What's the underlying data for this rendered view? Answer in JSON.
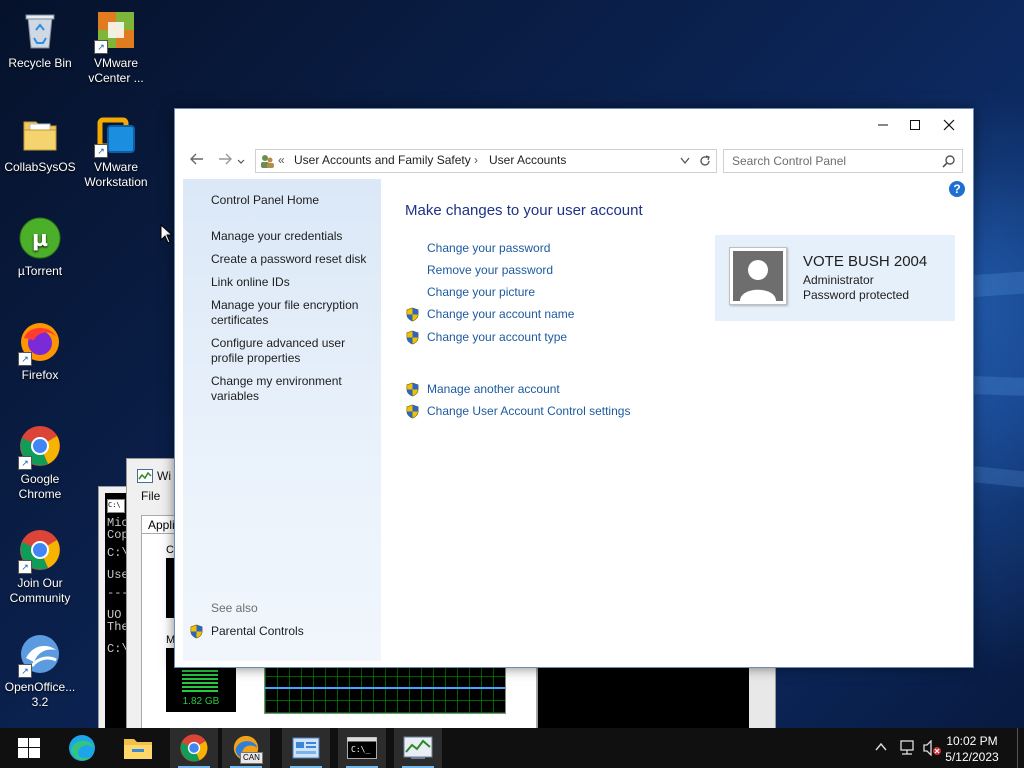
{
  "desktop": {
    "icons": [
      {
        "label": "Recycle Bin"
      },
      {
        "label": "VMware vCenter ..."
      },
      {
        "label": "CollabSysOS"
      },
      {
        "label": "VMware Workstation"
      },
      {
        "label": "µTorrent"
      },
      {
        "label": "Firefox"
      },
      {
        "label": "Google Chrome"
      },
      {
        "label": "Join Our Community"
      },
      {
        "label": "OpenOffice... 3.2"
      }
    ]
  },
  "background_windows": {
    "taskmgr_title": "Wi",
    "taskmgr_menu": "File",
    "taskmgr_tab": "Applic",
    "taskmgr_cpu": "CP",
    "taskmgr_mem": "Me",
    "taskmgr_mem_value": "1.82 GB",
    "cmd_lines": [
      "Mic",
      "Cop",
      "C:\\",
      "Use",
      "---",
      "UO",
      "The",
      "C:\\"
    ]
  },
  "window": {
    "breadcrumb": {
      "prefix": "«",
      "parent": "User Accounts and Family Safety",
      "separator": "›",
      "current": "User Accounts"
    },
    "search_placeholder": "Search Control Panel",
    "help_label": "?",
    "left_pane": {
      "home": "Control Panel Home",
      "links": [
        "Manage your credentials",
        "Create a password reset disk",
        "Link online IDs",
        "Manage your file encryption certificates",
        "Configure advanced user profile properties",
        "Change my environment variables"
      ],
      "see_also_label": "See also",
      "see_also": "Parental Controls"
    },
    "main": {
      "title": "Make changes to your user account",
      "tasks": [
        "Change your password",
        "Remove your password",
        "Change your picture",
        "Change your account name",
        "Change your account type"
      ],
      "other_tasks": [
        "Manage another account",
        "Change User Account Control settings"
      ]
    },
    "account": {
      "name": "VOTE BUSH 2004",
      "role": "Administrator",
      "status": "Password protected"
    }
  },
  "taskbar": {
    "time": "10:02 PM",
    "date": "5/12/2023",
    "badge_can": "CAN"
  },
  "colors": {
    "link": "#1e5aa0",
    "title": "#1e3287",
    "left_pane": "#dbe8f7",
    "taskbar": "#101010"
  }
}
